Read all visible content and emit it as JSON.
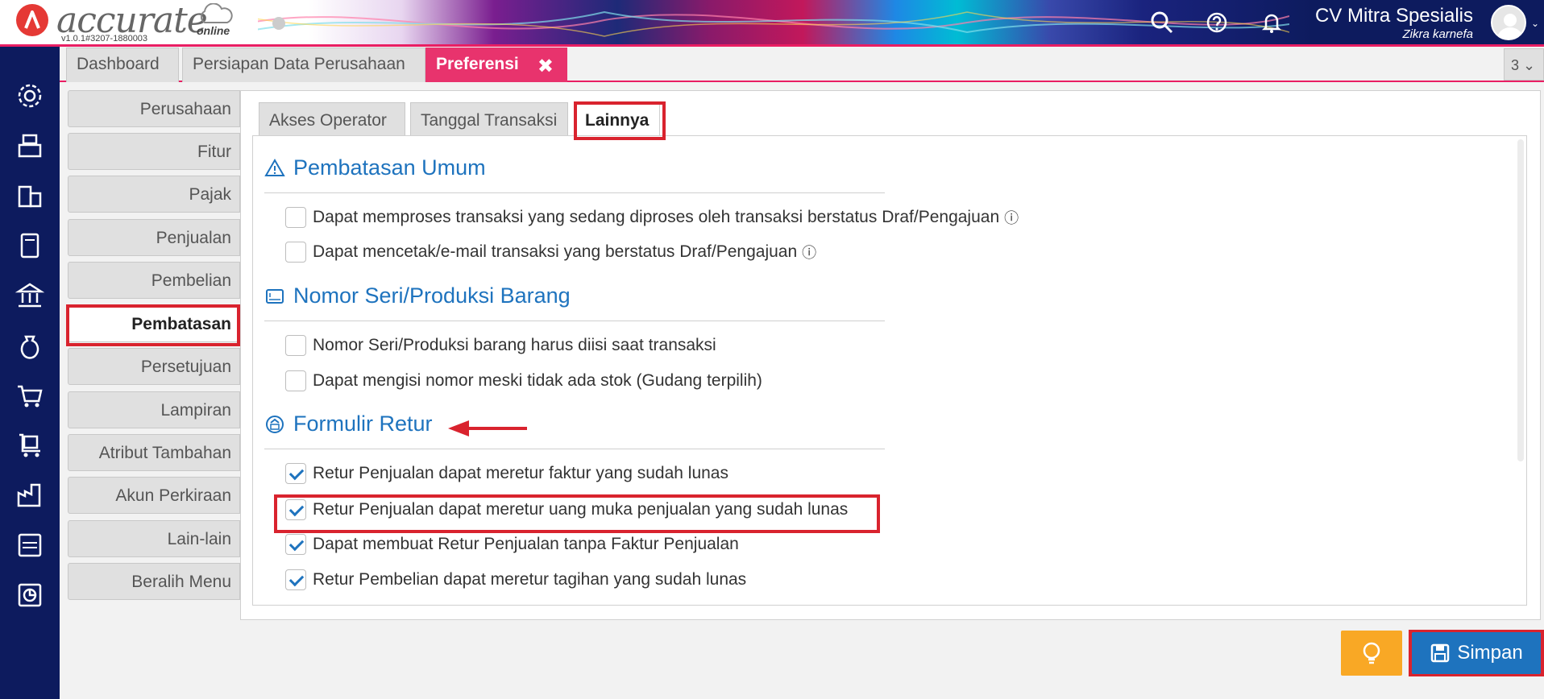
{
  "app": {
    "logo_text": "accurate",
    "logo_sub": "online",
    "version": "v1.0.1#3207-1880003",
    "company": "CV Mitra Spesialis",
    "user": "Zikra karnefa"
  },
  "top_tabs": {
    "tab1": "Dashboard",
    "tab2": "Persiapan Data Perusahaan",
    "tab3": "Preferensi",
    "close_glyph": "✖",
    "count": "3 ⌄"
  },
  "side_menu": [
    "Perusahaan",
    "Fitur",
    "Pajak",
    "Penjualan",
    "Pembelian",
    "Pembatasan",
    "Persetujuan",
    "Lampiran",
    "Atribut Tambahan",
    "Akun Perkiraan",
    "Lain-lain",
    "Beralih Menu"
  ],
  "sub_tabs": {
    "t1": "Akses Operator",
    "t2": "Tanggal Transaksi",
    "t3": "Lainnya"
  },
  "sections": {
    "umum": {
      "title": "Pembatasan Umum",
      "opt1": "Dapat memproses transaksi yang sedang diproses oleh transaksi berstatus Draf/Pengajuan",
      "opt2": "Dapat mencetak/e-mail transaksi yang berstatus Draf/Pengajuan",
      "info": "ⓘ"
    },
    "seri": {
      "title": "Nomor Seri/Produksi Barang",
      "opt1": "Nomor Seri/Produksi barang harus diisi saat transaksi",
      "opt2": "Dapat mengisi nomor meski tidak ada stok (Gudang terpilih)"
    },
    "retur": {
      "title": "Formulir Retur",
      "opt1": "Retur Penjualan dapat meretur faktur yang sudah lunas",
      "opt2": "Retur Penjualan dapat meretur uang muka penjualan yang sudah lunas",
      "opt3": "Dapat membuat Retur Penjualan tanpa Faktur Penjualan",
      "opt4": "Retur Pembelian dapat meretur tagihan yang sudah lunas"
    }
  },
  "buttons": {
    "save": "Simpan"
  },
  "colors": {
    "navy": "#0d1b5e",
    "accent": "#e8336d",
    "blue": "#1e73be",
    "annotation": "#d9232e"
  }
}
